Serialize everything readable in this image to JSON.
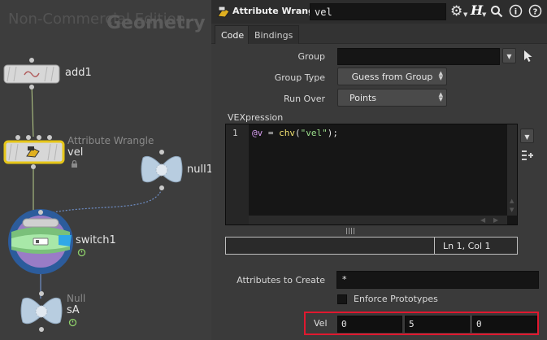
{
  "network": {
    "watermark_license": "Non-Commercial Edition",
    "watermark_context": "Geometry",
    "nodes": {
      "add": {
        "name": "add1"
      },
      "wrangle": {
        "type": "Attribute Wrangle",
        "name": "vel"
      },
      "null_top": {
        "name": "null1"
      },
      "switch": {
        "name": "switch1"
      },
      "null_bottom": {
        "type": "Null",
        "name": "sA"
      }
    }
  },
  "params": {
    "toolbar": {
      "op_type": "Attribute Wrangle",
      "node_name": "vel",
      "icons": [
        "wrangle-icon",
        "gear-icon",
        "help-h-icon",
        "search-icon",
        "info-icon",
        "help-icon"
      ]
    },
    "tabs": [
      {
        "label": "Code",
        "active": true
      },
      {
        "label": "Bindings",
        "active": false
      }
    ],
    "group": {
      "label": "Group",
      "value": ""
    },
    "group_type": {
      "label": "Group Type",
      "value": "Guess from Group"
    },
    "run_over": {
      "label": "Run Over",
      "value": "Points"
    },
    "vexpression": {
      "label": "VEXpression",
      "line_number": "1",
      "code_var": "@v",
      "code_eq": " = ",
      "code_func": "chv",
      "code_open": "(",
      "code_str": "\"vel\"",
      "code_close": ");"
    },
    "status": {
      "position": "Ln 1, Col 1"
    },
    "attributes_to_create": {
      "label": "Attributes to Create",
      "value": "*"
    },
    "enforce_prototypes": {
      "label": "Enforce Prototypes",
      "checked": false
    },
    "vel": {
      "label": "Vel",
      "values": [
        "0",
        "5",
        "0"
      ]
    }
  },
  "colors": {
    "highlight_border": "#e0182f",
    "selected_node": "#e6c619",
    "code_var": "#d69cf0",
    "code_func": "#f0e070",
    "code_string": "#9ce08c"
  }
}
